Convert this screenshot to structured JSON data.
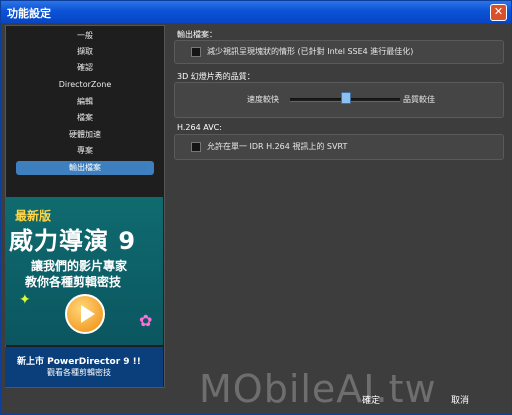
{
  "window": {
    "title": "功能設定"
  },
  "sidebar": {
    "items": [
      {
        "label": "一般",
        "selected": false
      },
      {
        "label": "擷取",
        "selected": false
      },
      {
        "label": "確認",
        "selected": false
      },
      {
        "label": "DirectorZone",
        "selected": false
      },
      {
        "label": "編輯",
        "selected": false
      },
      {
        "label": "檔案",
        "selected": false
      },
      {
        "label": "硬體加速",
        "selected": false
      },
      {
        "label": "專案",
        "selected": false
      },
      {
        "label": "輸出檔案",
        "selected": true
      }
    ]
  },
  "banner": {
    "new_version": "最新版",
    "title": "威力導演 9",
    "line1": "讓我們的影片專家",
    "line2": "教你各種剪輯密技",
    "bottom_line1": "新上市 PowerDirector 9 !!",
    "bottom_line2": "觀看各種剪輯密技"
  },
  "content": {
    "section_output": {
      "label": "輸出檔案：",
      "option": "減少視訊呈現塊狀的情形 (已針對 Intel SSE4 進行最佳化)"
    },
    "section_3d": {
      "label": "3D 幻燈片秀的品質：",
      "left_label": "速度較快",
      "right_label": "品質較佳",
      "slider_value_fraction": 0.46
    },
    "section_h264": {
      "label": "H.264 AVC:",
      "option": "允許在單一 IDR H.264 視訊上的 SVRT"
    }
  },
  "buttons": {
    "ok": "確定",
    "cancel": "取消"
  },
  "watermark": "MObileAI.tw"
}
